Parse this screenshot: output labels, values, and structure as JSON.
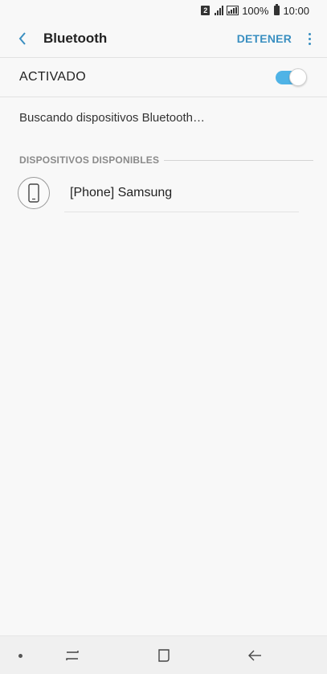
{
  "status_bar": {
    "sim_slot": "2",
    "battery_percent": "100%",
    "time": "10:00"
  },
  "app_bar": {
    "title": "Bluetooth",
    "stop_label": "DETENER"
  },
  "master_toggle": {
    "label": "ACTIVADO",
    "state": "on",
    "accent_color": "#4fb3e6"
  },
  "status_text": "Buscando dispositivos Bluetooth…",
  "available_devices": {
    "header": "DISPOSITIVOS DISPONIBLES",
    "items": [
      {
        "name": "[Phone] Samsung",
        "icon": "smartphone-icon"
      }
    ]
  },
  "nav_bar": {
    "icons": [
      "dot-indicator",
      "recent-apps-icon",
      "home-icon",
      "back-arrow-icon"
    ]
  }
}
